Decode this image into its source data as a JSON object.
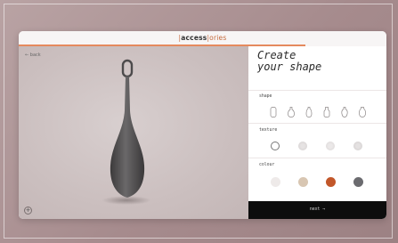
{
  "brand": {
    "prefix": "|",
    "name": "access",
    "suffix": "|ories"
  },
  "viewer": {
    "back_label": "← back",
    "zoom_in_label": "+",
    "zoom_out_label": "−"
  },
  "panel": {
    "title": "Create\nyour shape",
    "shape_label": "shape",
    "texture_label": "texture",
    "colour_label": "colour",
    "colours": [
      "#eeeae9",
      "#d8c6b2",
      "#c2572a",
      "#6b6b6f"
    ],
    "next_label": "next →"
  },
  "accent_color": "#e58a5e"
}
